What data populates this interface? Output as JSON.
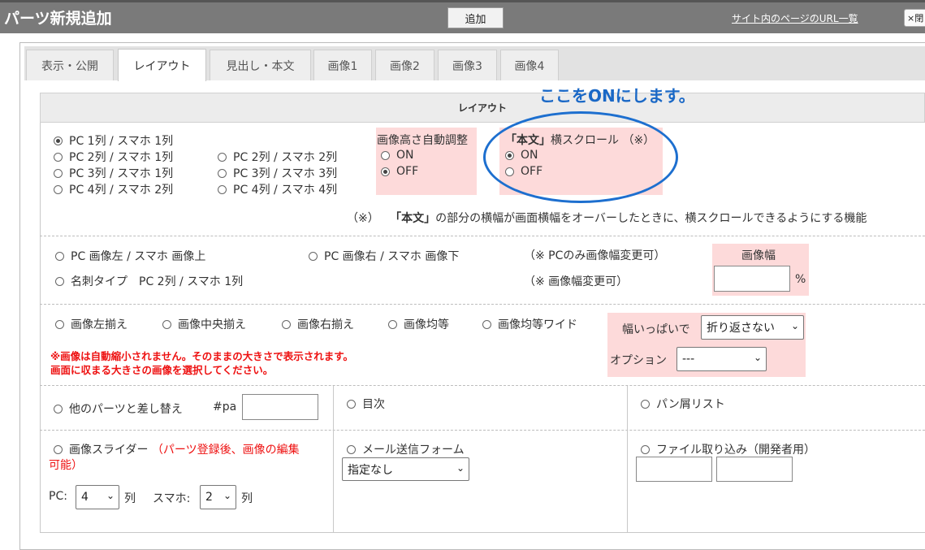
{
  "header": {
    "title": "パーツ新規追加",
    "add_button": "追加",
    "url_list_link": "サイト内のページのURL一覧",
    "close_label": "×閉"
  },
  "tabs": [
    {
      "label": "表示・公開",
      "active": false
    },
    {
      "label": "レイアウト",
      "active": true
    },
    {
      "label": "見出し・本文",
      "active": false
    },
    {
      "label": "画像1",
      "active": false
    },
    {
      "label": "画像2",
      "active": false
    },
    {
      "label": "画像3",
      "active": false
    },
    {
      "label": "画像4",
      "active": false
    }
  ],
  "section_header": "レイアウト",
  "annotation": "ここをONにします。",
  "layout_columns": [
    {
      "label": "PC 1列 / スマホ 1列",
      "checked": true
    },
    {
      "label": "PC 2列 / スマホ 1列",
      "checked": false
    },
    {
      "label": "PC 3列 / スマホ 1列",
      "checked": false
    },
    {
      "label": "PC 4列 / スマホ 2列",
      "checked": false
    },
    {
      "label": "PC 2列 / スマホ 2列",
      "checked": false
    },
    {
      "label": "PC 3列 / スマホ 3列",
      "checked": false
    },
    {
      "label": "PC 4列 / スマホ 4列",
      "checked": false
    }
  ],
  "auto_height": {
    "title": "画像高さ自動調整",
    "on": "ON",
    "off": "OFF",
    "selected": "OFF"
  },
  "hscroll": {
    "title_bold": "「本文」",
    "title_rest": "横スクロール （※）",
    "on": "ON",
    "off": "OFF",
    "selected": "ON"
  },
  "note": {
    "mark": "（※）",
    "bold": "「本文」",
    "text": "の部分の横幅が画面横幅をオーバーしたときに、横スクロールできるようにする機能"
  },
  "image_position": {
    "opt1": "PC 画像左 / スマホ 画像上",
    "opt2": "PC 画像右 / スマホ 画像下",
    "opt3": "名刺タイプ　PC 2列 / スマホ 1列",
    "note1": "（※ PCのみ画像幅変更可）",
    "note2": "（※ 画像幅変更可）",
    "width_label": "画像幅",
    "width_unit": "%"
  },
  "align": {
    "left": "画像左揃え",
    "center": "画像中央揃え",
    "right": "画像右揃え",
    "even": "画像均等",
    "even_wide": "画像均等ワイド",
    "warning1": "※画像は自動縮小されません。そのままの大きさで表示されます。",
    "warning2": "画面に収まる大きさの画像を選択してください。",
    "fullwidth_label": "幅いっぱいで",
    "fullwidth_value": "折り返さない",
    "option_label": "オプション",
    "option_value": "---"
  },
  "other": {
    "replace_label": "他のパーツと差し替え",
    "replace_prefix": "#pa",
    "toc": "目次",
    "breadcrumb": "パン屑リスト",
    "slider_label": "画像スライダー",
    "slider_note1": "（パーツ登録後、画像の編集",
    "slider_note2": "可能）",
    "pc_label": "PC:",
    "pc_value": "4",
    "col_unit1": "列",
    "sp_label": "スマホ:",
    "sp_value": "2",
    "col_unit2": "列",
    "mail_form": "メール送信フォーム",
    "mail_select": "指定なし",
    "file_import": "ファイル取り込み（開発者用）"
  },
  "colors": {
    "topbar": "#7a7a7a",
    "pink_highlight": "#fddada",
    "annotation_blue": "#1a68c6",
    "warning_red": "#e11111"
  }
}
